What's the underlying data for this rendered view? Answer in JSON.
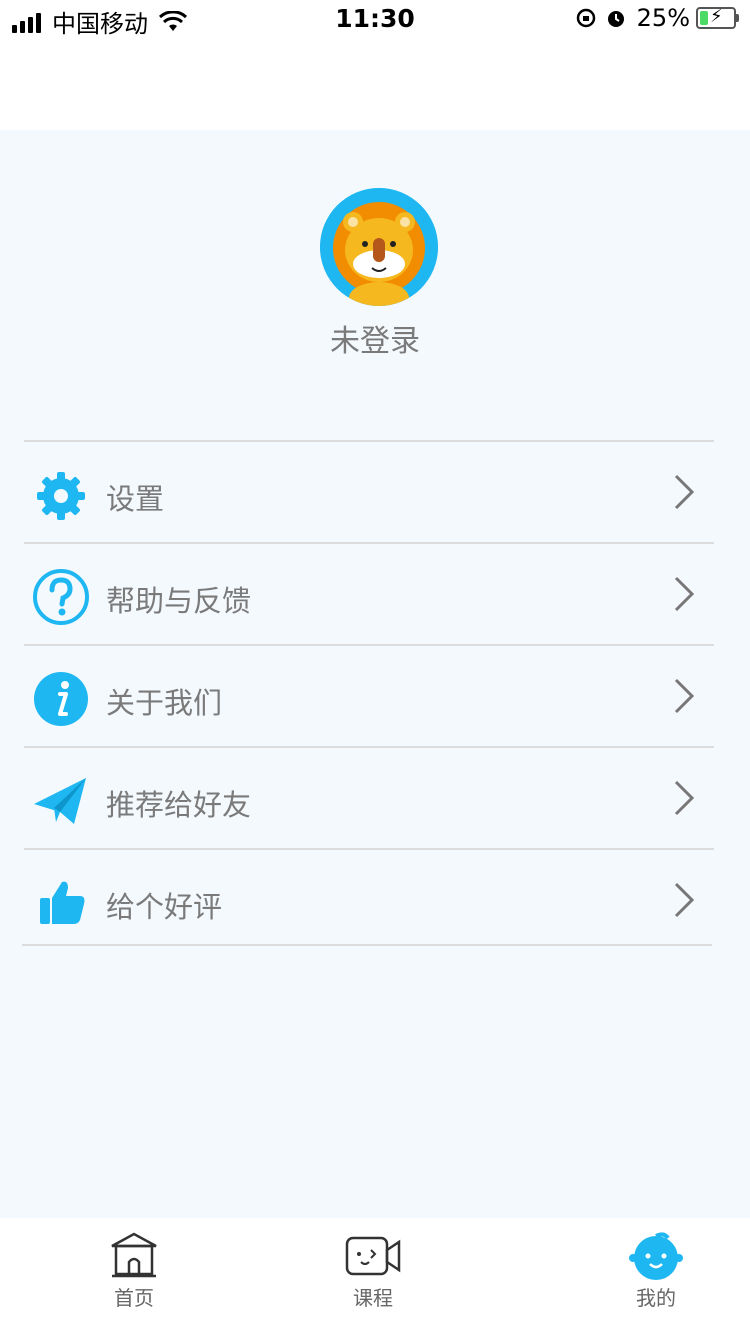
{
  "status_bar": {
    "carrier": "中国移动",
    "time": "11:30",
    "battery": "25%",
    "battery_level": 0.25
  },
  "profile": {
    "username": "未登录",
    "avatar_icon": "lion-avatar-icon"
  },
  "menu": {
    "items": [
      {
        "label": "设置",
        "icon": "gear-icon"
      },
      {
        "label": "帮助与反馈",
        "icon": "help-icon"
      },
      {
        "label": "关于我们",
        "icon": "info-icon"
      },
      {
        "label": "推荐给好友",
        "icon": "paper-plane-icon"
      },
      {
        "label": "给个好评",
        "icon": "thumbs-up-icon"
      }
    ]
  },
  "tabbar": {
    "tabs": [
      {
        "label": "首页",
        "icon": "home-icon"
      },
      {
        "label": "课程",
        "icon": "video-icon"
      },
      {
        "label": "我的",
        "icon": "baby-face-icon",
        "active": true
      }
    ]
  },
  "colors": {
    "accent": "#1fb7f1",
    "text_gray": "#7a7a7a",
    "background": "#f4f9fe"
  }
}
